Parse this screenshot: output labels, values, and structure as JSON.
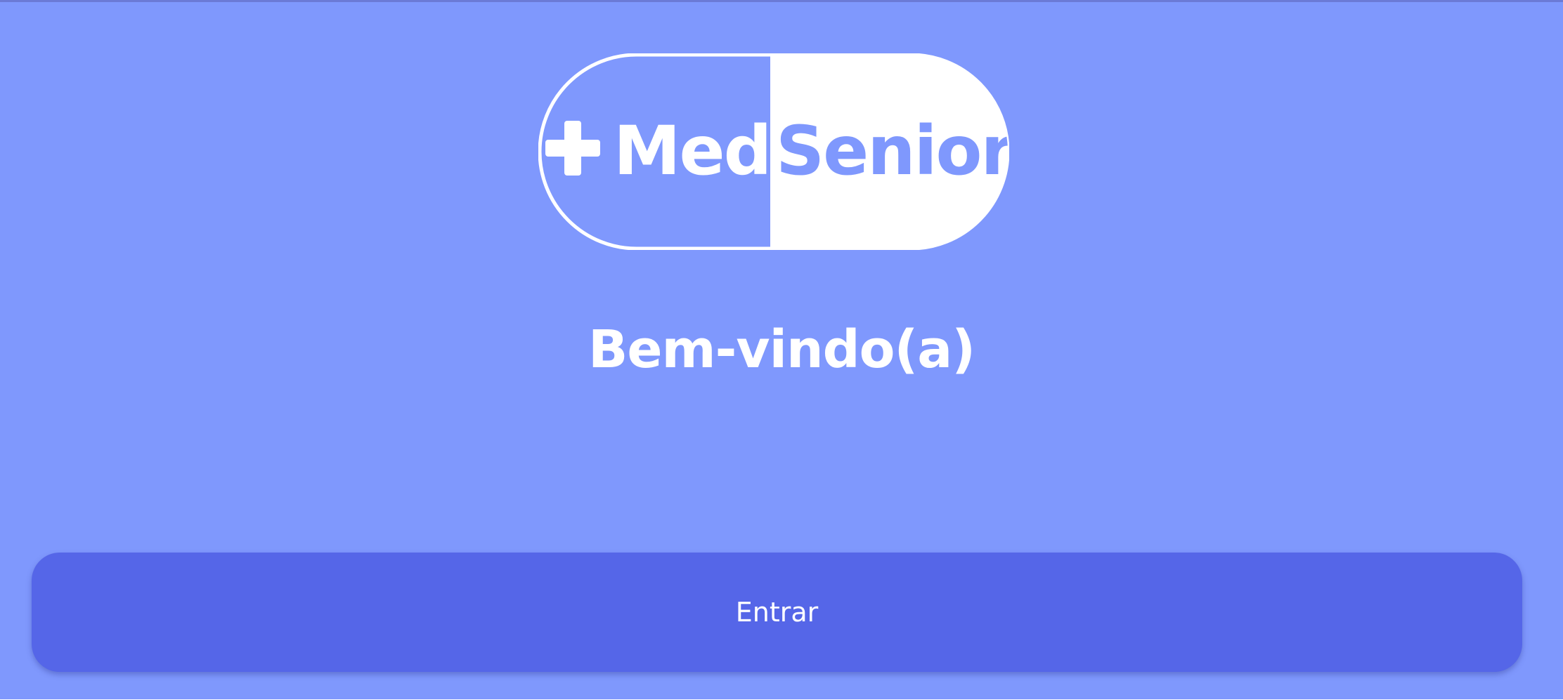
{
  "logo": {
    "name": "+MedSenior",
    "left_text": "Med",
    "right_text": "Senior",
    "fill_color": "#ffffff",
    "bg_color": "#7f98fd"
  },
  "welcome": {
    "title": "Bem-vindo(a)"
  },
  "actions": {
    "enter_label": "Entrar"
  },
  "colors": {
    "background": "#7f98fd",
    "button": "#5566e8",
    "text": "#ffffff"
  }
}
